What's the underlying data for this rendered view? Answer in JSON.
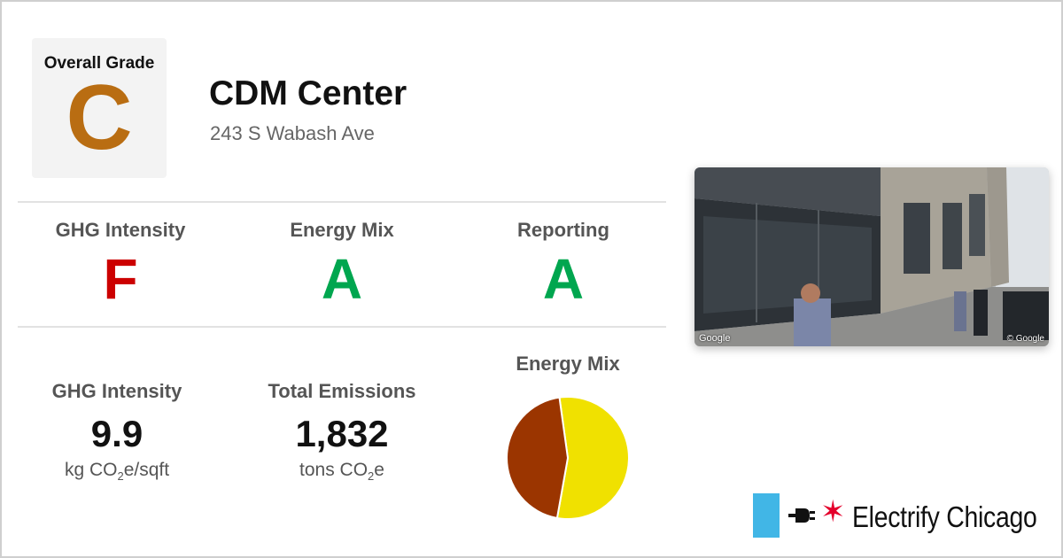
{
  "overall": {
    "label": "Overall Grade",
    "grade": "C",
    "color": "#b96d12"
  },
  "building": {
    "name": "CDM Center",
    "address": "243 S Wabash Ave"
  },
  "grades": [
    {
      "label": "GHG Intensity",
      "grade": "F",
      "color": "#cc0000"
    },
    {
      "label": "Energy Mix",
      "grade": "A",
      "color": "#00a64f"
    },
    {
      "label": "Reporting",
      "grade": "A",
      "color": "#00a64f"
    }
  ],
  "stats": [
    {
      "label": "GHG Intensity",
      "value": "9.9",
      "unit_pre": "kg CO",
      "unit_sub": "2",
      "unit_post": "e/sqft"
    },
    {
      "label": "Total Emissions",
      "value": "1,832",
      "unit_pre": "tons CO",
      "unit_sub": "2",
      "unit_post": "e"
    }
  ],
  "energy_mix": {
    "title": "Energy Mix",
    "colors": [
      "#f0e100",
      "#9b3500"
    ]
  },
  "chart_data": {
    "type": "pie",
    "title": "Energy Mix",
    "values": [
      0.55,
      0.45
    ],
    "colors": [
      "#f0e100",
      "#9b3500"
    ]
  },
  "photo": {
    "watermark_left": "Google",
    "watermark_right": "© Google"
  },
  "brand": {
    "text": "Electrify Chicago",
    "bar_color": "#41b6e6",
    "star_color": "#e4002b",
    "icons": [
      "plug-icon",
      "chicago-star-icon"
    ]
  }
}
